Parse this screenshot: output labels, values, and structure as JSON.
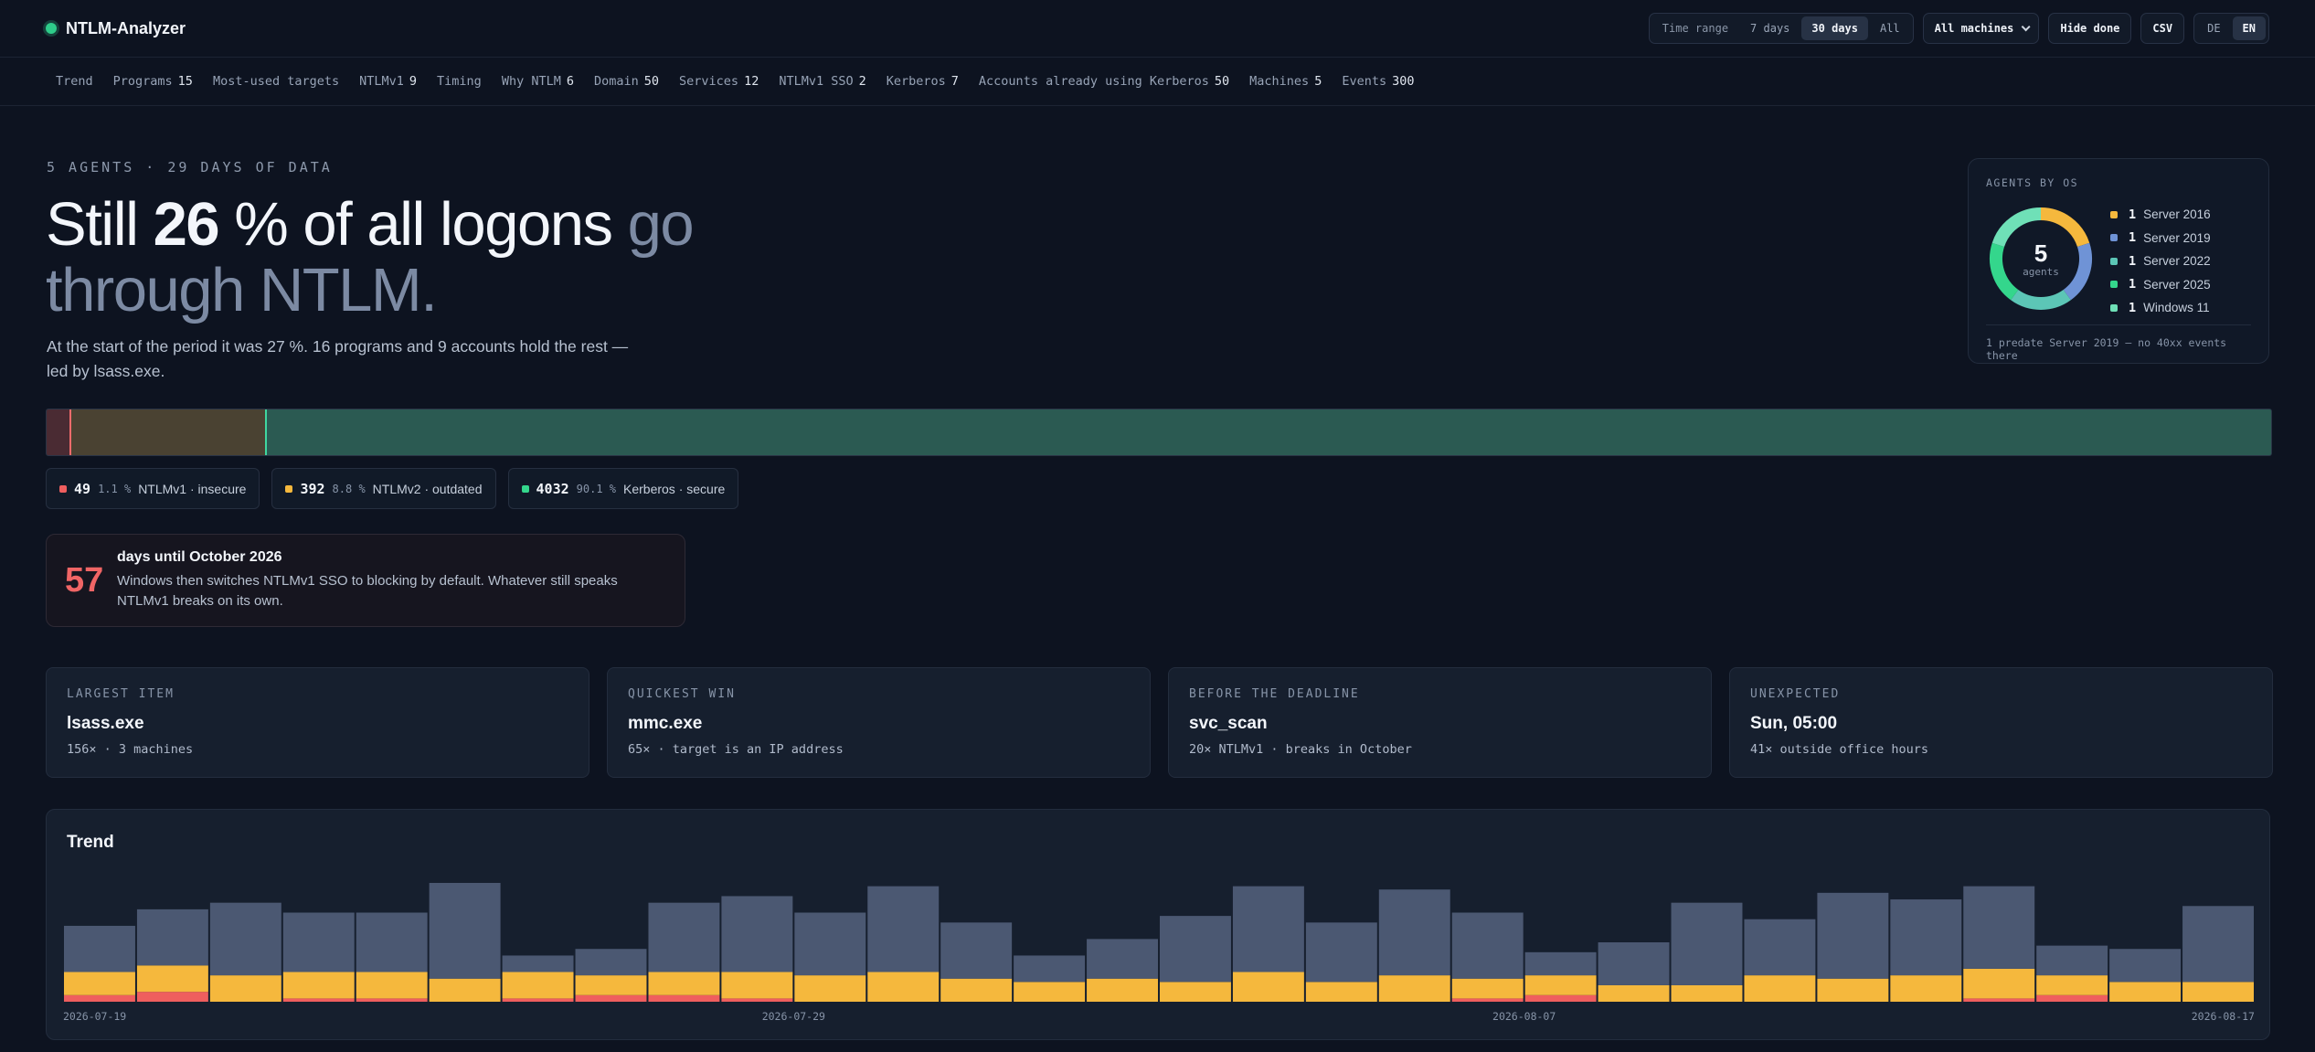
{
  "app": {
    "title": "NTLM-Analyzer"
  },
  "header": {
    "time_range_label": "Time range",
    "time_ranges": [
      "7 days",
      "30 days",
      "All"
    ],
    "time_range_selected": "30 days",
    "machine_select": "All machines",
    "hide_done_label": "Hide done",
    "csv_label": "CSV",
    "languages": [
      "DE",
      "EN"
    ],
    "language_selected": "EN"
  },
  "tabs": [
    {
      "label": "Trend",
      "count": ""
    },
    {
      "label": "Programs",
      "count": "15"
    },
    {
      "label": "Most-used targets",
      "count": ""
    },
    {
      "label": "NTLMv1",
      "count": "9"
    },
    {
      "label": "Timing",
      "count": ""
    },
    {
      "label": "Why NTLM",
      "count": "6"
    },
    {
      "label": "Domain",
      "count": "50"
    },
    {
      "label": "Services",
      "count": "12"
    },
    {
      "label": "NTLMv1 SSO",
      "count": "2"
    },
    {
      "label": "Kerberos",
      "count": "7"
    },
    {
      "label": "Accounts already using Kerberos",
      "count": "50"
    },
    {
      "label": "Machines",
      "count": "5"
    },
    {
      "label": "Events",
      "count": "300"
    }
  ],
  "hero": {
    "eyebrow": "5 AGENTS · 29 DAYS OF DATA",
    "headline_prefix": "Still ",
    "headline_number": "26",
    "headline_mid": " % of all logons ",
    "headline_muted_1": "go",
    "headline_muted_2": "through NTLM.",
    "lead": "At the start of the period it was 27 %. 16 programs and 9 accounts hold the rest — led by lsass.exe."
  },
  "os_card": {
    "title": "AGENTS BY OS",
    "total": "5",
    "total_label": "agents",
    "items": [
      {
        "count": "1",
        "name": "Server 2016",
        "color": "#f5b83d",
        "value": 1
      },
      {
        "count": "1",
        "name": "Server 2019",
        "color": "#6f93d6",
        "value": 1
      },
      {
        "count": "1",
        "name": "Server 2022",
        "color": "#5cc6b6",
        "value": 1
      },
      {
        "count": "1",
        "name": "Server 2025",
        "color": "#34d68c",
        "value": 1
      },
      {
        "count": "1",
        "name": "Windows 11",
        "color": "#6fe0b7",
        "value": 1
      }
    ],
    "footnote": "1 predate Server 2019 — no 40xx events there"
  },
  "distribution": [
    {
      "count": "49",
      "pct": "1.1 %",
      "label": "NTLMv1 · insecure",
      "color": "#ef5e5e",
      "value": 1.1
    },
    {
      "count": "392",
      "pct": "8.8 %",
      "label": "NTLMv2 · outdated",
      "color": "#f5b83d",
      "value": 8.8
    },
    {
      "count": "4032",
      "pct": "90.1 %",
      "label": "Kerberos · secure",
      "color": "#34d68c",
      "value": 90.1
    }
  ],
  "deadline": {
    "days": "57",
    "title": "days until October 2026",
    "text": "Windows then switches NTLMv1 SSO to blocking by default. Whatever still speaks NTLMv1 breaks on its own."
  },
  "cards": [
    {
      "key": "LARGEST ITEM",
      "value": "lsass.exe",
      "detail": "156× · 3 machines"
    },
    {
      "key": "QUICKEST WIN",
      "value": "mmc.exe",
      "detail": "65× · target is an IP address"
    },
    {
      "key": "BEFORE THE DEADLINE",
      "value": "svc_scan",
      "detail": "20× NTLMv1 · breaks in October"
    },
    {
      "key": "UNEXPECTED",
      "value": "Sun, 05:00",
      "detail": "41× outside office hours"
    }
  ],
  "chart_data": {
    "type": "bar",
    "title": "Trend",
    "stacked": true,
    "x_tick_labels": [
      "2026-07-19",
      "2026-07-29",
      "2026-08-07",
      "2026-08-17"
    ],
    "series": [
      {
        "color": "#ef5e5e",
        "values": [
          2,
          3,
          0,
          1,
          1,
          0,
          1,
          2,
          2,
          1,
          0,
          0,
          0,
          0,
          0,
          0,
          0,
          0,
          0,
          1,
          2,
          0,
          0,
          0,
          0,
          0,
          1,
          2,
          0,
          0
        ]
      },
      {
        "color": "#f5b83d",
        "values": [
          7,
          8,
          8,
          8,
          8,
          7,
          8,
          6,
          7,
          8,
          8,
          9,
          7,
          6,
          7,
          6,
          9,
          6,
          8,
          6,
          6,
          5,
          5,
          8,
          7,
          8,
          9,
          6,
          6,
          6
        ]
      },
      {
        "color": "#4b5872",
        "values": [
          14,
          17,
          22,
          18,
          18,
          29,
          5,
          8,
          21,
          23,
          19,
          26,
          17,
          8,
          12,
          20,
          26,
          18,
          26,
          20,
          7,
          13,
          25,
          17,
          26,
          23,
          25,
          9,
          10,
          23
        ]
      }
    ],
    "grid": false,
    "legend": "none"
  },
  "colors": {
    "background": "#0d1320",
    "accent_green": "#34d68c",
    "danger": "#ef5e5e",
    "warning": "#f5b83d"
  }
}
